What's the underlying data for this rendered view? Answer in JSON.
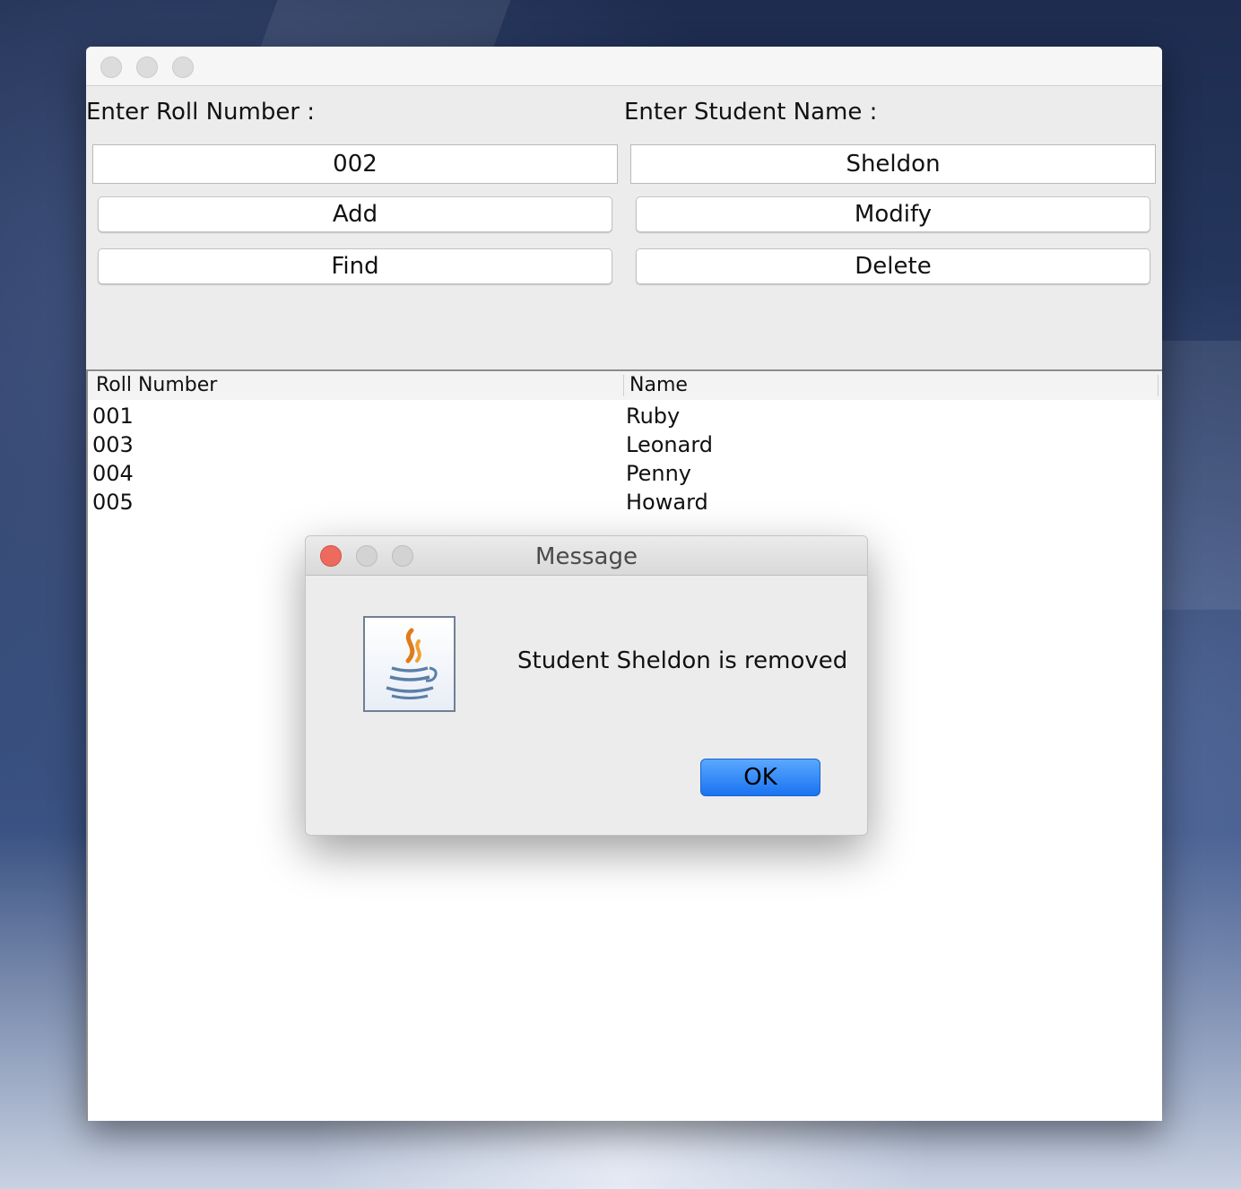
{
  "form": {
    "roll_label": "Enter Roll Number :",
    "name_label": "Enter Student Name :",
    "roll_value": "002",
    "name_value": "Sheldon"
  },
  "buttons": {
    "add": "Add",
    "modify": "Modify",
    "find": "Find",
    "delete": "Delete"
  },
  "table": {
    "headers": [
      "Roll Number",
      "Name"
    ],
    "rows": [
      [
        "001",
        "Ruby"
      ],
      [
        "003",
        "Leonard"
      ],
      [
        "004",
        "Penny"
      ],
      [
        "005",
        "Howard"
      ]
    ]
  },
  "dialog": {
    "title": "Message",
    "message": "Student Sheldon is removed",
    "ok_label": "OK",
    "icon": "java-coffee-icon"
  },
  "colors": {
    "dialog_close": "#ec6a5e",
    "ok_button": "#1a73f0"
  }
}
